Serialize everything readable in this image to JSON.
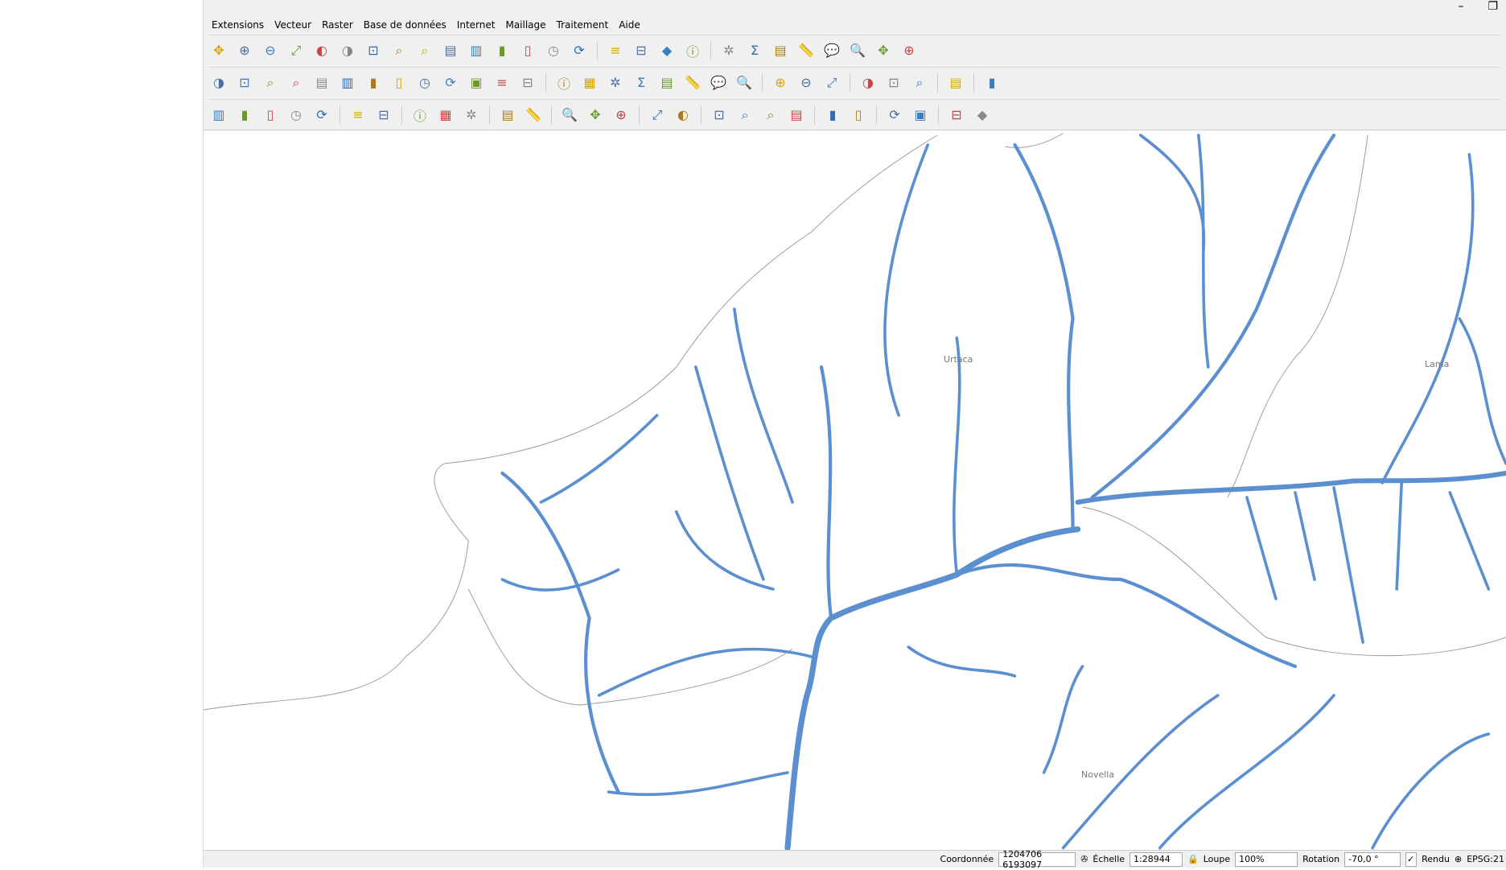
{
  "menu": [
    "Extensions",
    "Vecteur",
    "Raster",
    "Base de données",
    "Internet",
    "Maillage",
    "Traitement",
    "Aide"
  ],
  "window": {
    "minimize": "–",
    "restore": "❐"
  },
  "toolbars": {
    "row1": [
      "pan-icon",
      "zoom-in-icon",
      "zoom-out-icon",
      "zoom-full-icon",
      "zoom-selection-icon",
      "zoom-layer-icon",
      "zoom-native-icon",
      "zoom-last-icon",
      "zoom-next-icon",
      "new-bookmark-icon",
      "show-bookmarks-icon",
      "new-map-view-icon",
      "new-3d-view-icon",
      "temporal-icon",
      "refresh-icon",
      "|",
      "select-icon",
      "select-value-icon",
      "deselect-icon",
      "select-location-icon",
      "|",
      "identify-icon",
      "attribute-table-icon",
      "toolbox-icon",
      "statistics-icon",
      "field-calculator-icon",
      "measure-icon",
      "map-tips-icon",
      "search-icon"
    ],
    "row2": [
      "digitize-icon",
      "toggle-edit-icon",
      "save-edits-icon",
      "add-feature-icon",
      "add-polygon-icon",
      "vertex-tool-icon",
      "modify-attributes-icon",
      "delete-icon",
      "cut-icon",
      "copy-icon",
      "paste-icon",
      "undo-icon",
      "redo-icon",
      "|",
      "label-icon",
      "diagram-icon",
      "pin-label-icon",
      "show-label-icon",
      "move-label-icon",
      "rotate-label-icon",
      "change-label-icon",
      "label-props-icon",
      "|",
      "wms-icon",
      "wfs-icon",
      "globe-icon",
      "|",
      "python-icon",
      "plugin-icon",
      "metasearch-icon",
      "|",
      "help-icon",
      "|",
      "georef-icon"
    ],
    "row3": [
      "text-icon",
      "text-minus-icon",
      "text-plus-icon",
      "text-box-icon",
      "image-icon",
      "|",
      "db-icon",
      "arrow-icon",
      "|",
      "find-icon",
      "whats-this-icon",
      "pdf-icon",
      "|",
      "cut-tool-icon",
      "help-circle-icon",
      "|",
      "capture-icon",
      "screenshot-icon",
      "swap-icon",
      "|",
      "annotation-icon",
      "crosshair-icon",
      "|",
      "grid-icon",
      "move-icon",
      "shape-icon",
      "pointer-icon",
      "|",
      "info-icon",
      "wrench-icon",
      "|",
      "zoom-tool-icon",
      "zoom-tool2-icon",
      "|",
      "tool-icon",
      "table-icon"
    ]
  },
  "map": {
    "labels": {
      "urtaca": "Urtaca",
      "lama": "Lama",
      "novella": "Novella"
    },
    "river_color": "#5b8fcf",
    "border_color": "#9a9a9a"
  },
  "status": {
    "coord_label": "Coordonnée",
    "coord_value": "1204706 6193097",
    "scale_label": "Échelle",
    "scale_value": "1:28944",
    "magnifier_label": "Loupe",
    "magnifier_value": "100%",
    "rotation_label": "Rotation",
    "rotation_value": "-70,0 °",
    "render_label": "Rendu",
    "render_checked": "✓",
    "crs": "EPSG:21"
  }
}
